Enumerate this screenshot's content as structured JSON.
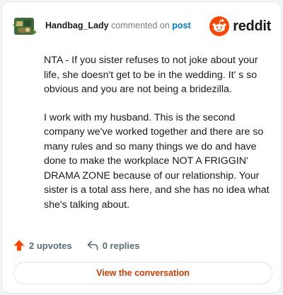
{
  "header": {
    "username": "Handbag_Lady",
    "action_text": "commented on",
    "target_link": "post",
    "brand_name": "reddit"
  },
  "comment": {
    "paragraphs": [
      "NTA - If you sister refuses to not joke about your life, she doesn't get to be in the wedding. It' s so obvious and you are not being a bridezilla.",
      "I work with my husband. This is the second company we've worked together and there are so many rules and so many things we do and have done to make the workplace NOT A FRIGGIN' DRAMA ZONE because of our relationship. Your sister is a total ass here, and she has no idea what she's talking about."
    ]
  },
  "actions": {
    "upvotes_label": "2 upvotes",
    "replies_label": "0 replies"
  },
  "cta": {
    "label": "View the conversation"
  },
  "colors": {
    "brand_orange": "#ff4500",
    "cta_text": "#d93a00",
    "link_blue": "#0079d3"
  },
  "icons": {
    "upvote": "upvote-arrow-icon",
    "reply": "reply-arrow-icon",
    "brand": "reddit-snoo-icon"
  }
}
